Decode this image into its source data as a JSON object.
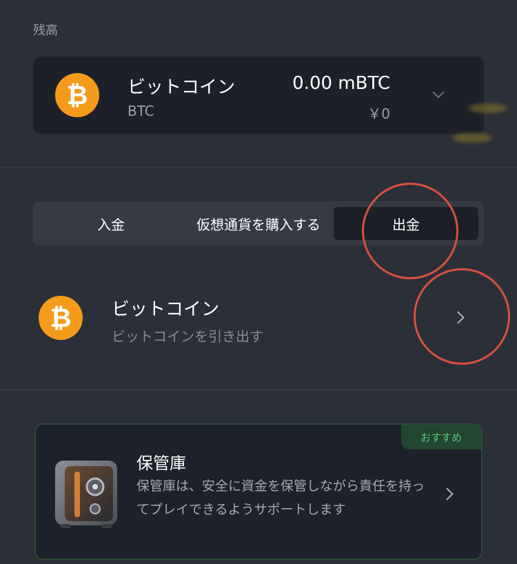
{
  "balance": {
    "label": "残高",
    "coin_name": "ビットコイン",
    "coin_ticker": "BTC",
    "amount": "0.00 mBTC",
    "fiat_value": "￥0",
    "coin_symbol": "₿"
  },
  "tabs": [
    {
      "label": "入金",
      "active": false
    },
    {
      "label": "仮想通貨を購入する",
      "active": false
    },
    {
      "label": "出金",
      "active": true
    }
  ],
  "withdraw_item": {
    "title": "ビットコイン",
    "subtitle": "ビットコインを引き出す",
    "coin_symbol": "₿"
  },
  "vault": {
    "badge": "おすすめ",
    "title": "保管庫",
    "description": "保管庫は、安全に資金を保管しながら責任を持ってプレイできるようサポートします"
  },
  "colors": {
    "background": "#2b2f37",
    "card": "#1d2029",
    "btc_orange": "#f49b1b",
    "annotation_red": "#d9503f",
    "badge_green": "#58c77a"
  },
  "icons": {
    "coin": "bitcoin-icon",
    "dropdown": "chevron-down-icon",
    "navigate": "chevron-right-icon",
    "vault": "safe-icon"
  }
}
